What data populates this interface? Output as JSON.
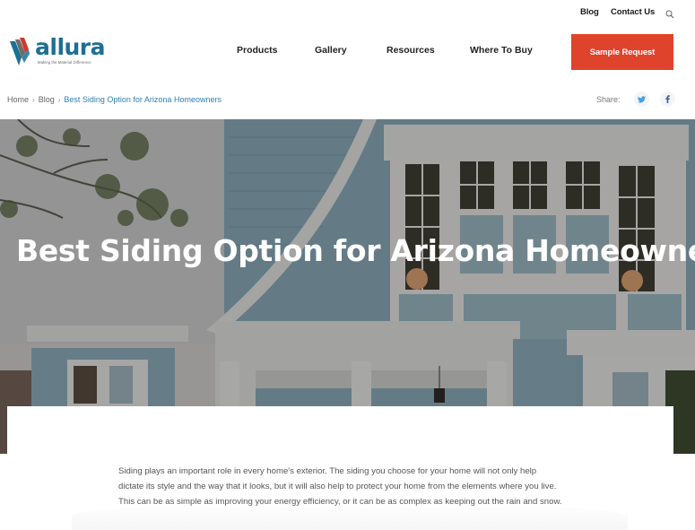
{
  "utility_nav": {
    "blog": "Blog",
    "contact": "Contact Us",
    "search_icon": "search-icon"
  },
  "brand": {
    "name": "allura",
    "trademark": "™",
    "tagline": "Making the Material Difference",
    "colors": {
      "primary_blue": "#1d6f93",
      "accent_red": "#d23a2c",
      "gray": "#6d6d6d"
    }
  },
  "main_nav": {
    "items": [
      {
        "label": "Products"
      },
      {
        "label": "Gallery"
      },
      {
        "label": "Resources"
      },
      {
        "label": "Where To Buy"
      }
    ],
    "cta_label": "Sample Request",
    "cta_color": "#e0432b"
  },
  "breadcrumb": {
    "items": [
      {
        "label": "Home"
      },
      {
        "label": "Blog"
      },
      {
        "label": "Best Siding Option for Arizona Homeowners"
      }
    ],
    "separator": "›"
  },
  "share": {
    "label": "Share:",
    "networks": [
      {
        "name": "twitter",
        "icon": "twitter-icon",
        "color": "#3fa0e6"
      },
      {
        "name": "facebook",
        "icon": "facebook-icon",
        "color": "#3b5998"
      }
    ]
  },
  "hero": {
    "title": "Best Siding Option for Arizona Homeowners",
    "image_alt": "Blue-sided two-story house with white trim and windows"
  },
  "article": {
    "intro": "Siding plays an important role in every home's exterior. The siding you choose for your home will not only help dictate its style and the way that it looks, but it will also help to protect your home from the elements where you live. This can be as simple as improving your energy efficiency, or it can be as complex as keeping out the rain and snow."
  }
}
